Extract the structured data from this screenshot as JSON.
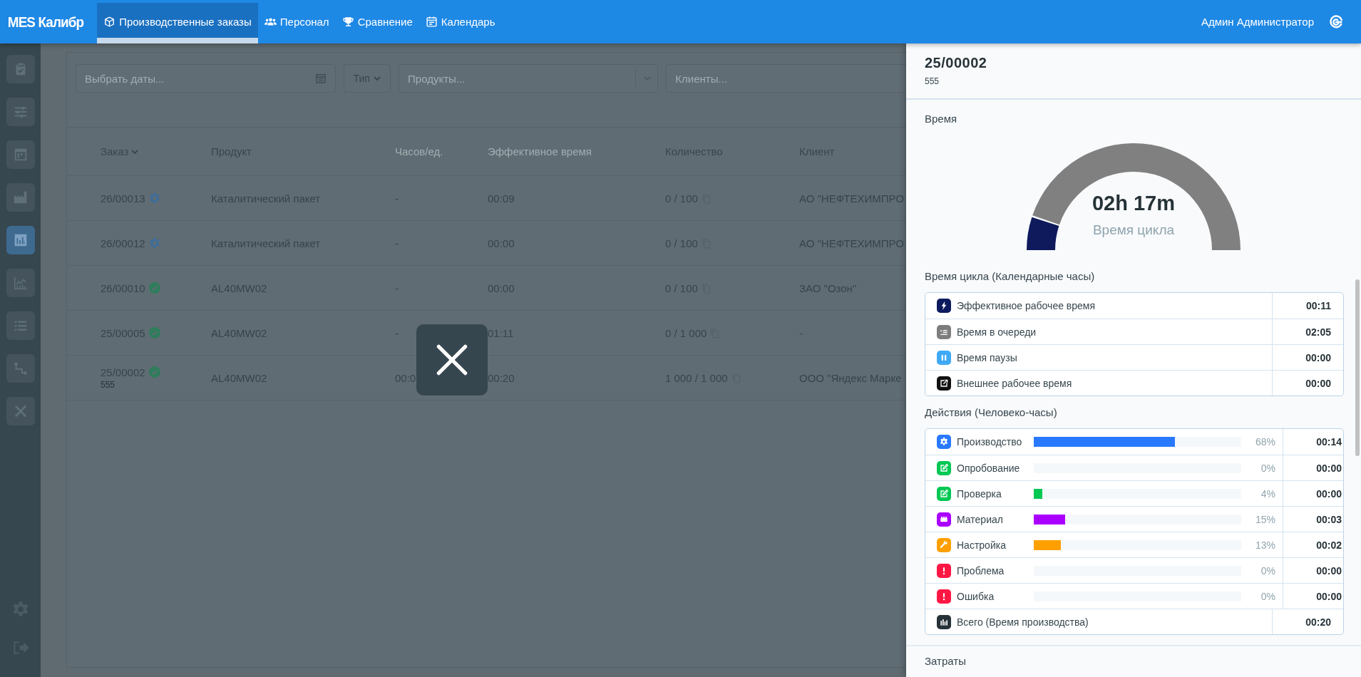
{
  "topbar": {
    "logo": "MES Калибр",
    "tabs": [
      {
        "label": "Производственные заказы",
        "selected": true
      },
      {
        "label": "Персонал",
        "selected": false
      },
      {
        "label": "Сравнение",
        "selected": false
      },
      {
        "label": "Календарь",
        "selected": false
      }
    ],
    "user": "Админ Администратор"
  },
  "sidebar": {
    "items": [
      {
        "selected": false
      },
      {
        "selected": false
      },
      {
        "selected": false
      },
      {
        "selected": false
      },
      {
        "selected": true
      },
      {
        "selected": false
      },
      {
        "selected": false
      },
      {
        "selected": false
      },
      {
        "selected": false
      }
    ]
  },
  "filters": {
    "dates": {
      "placeholder": "Выбрать даты..."
    },
    "type": {
      "label": "Тип"
    },
    "products": {
      "placeholder": "Продукты..."
    },
    "clients": {
      "placeholder": "Клиенты..."
    }
  },
  "table": {
    "columns": [
      {
        "label": "Заказ",
        "sorted": true,
        "dimmed": false
      },
      {
        "label": "Продукт",
        "sorted": false,
        "dimmed": false
      },
      {
        "label": "Часов/ед.",
        "sorted": false,
        "dimmed": true
      },
      {
        "label": "Эффективное время",
        "sorted": false,
        "dimmed": true
      },
      {
        "label": "Количество",
        "sorted": false,
        "dimmed": false
      },
      {
        "label": "Клиент",
        "sorted": false,
        "dimmed": false
      }
    ],
    "rows": [
      {
        "order": "26/00013",
        "completed": false,
        "product": "Каталитический пакет",
        "hours": "-",
        "effective_time": "00:09",
        "quantity": "0 / 100",
        "client": "АО \"НЕФТЕХИМПРО"
      },
      {
        "order": "26/00012",
        "completed": false,
        "product": "Каталитический пакет",
        "hours": "-",
        "effective_time": "00:00",
        "quantity": "0 / 100",
        "client": "АО \"НЕФТЕХИМПРО"
      },
      {
        "order": "26/00010",
        "completed": true,
        "product": "AL40MW02",
        "hours": "-",
        "effective_time": "00:00",
        "quantity": "0 / 100",
        "client": "ЗАО \"Озон\""
      },
      {
        "order": "25/00005",
        "completed": true,
        "product": "AL40MW02",
        "hours": "-",
        "effective_time": "01:11",
        "quantity": "0 / 1 000",
        "client": "-"
      },
      {
        "order": "25/00002",
        "completed": true,
        "note": "555",
        "product": "AL40MW02",
        "hours": "00:0",
        "effective_time": "00:20",
        "quantity": "1 000 / 1 000",
        "client": "ООО \"Яндекс Марке"
      }
    ]
  },
  "panel": {
    "title": "25/00002",
    "subtitle": "555",
    "time_section": "Время",
    "gauge": {
      "value": "02h 17m",
      "caption": "Время цикла"
    },
    "cycle_heading": "Время цикла (Календарные часы)",
    "cycle_rows": [
      {
        "label": "Эффективное рабочее время",
        "value": "00:11",
        "color": "#0d1b5e"
      },
      {
        "label": "Время в очереди",
        "value": "02:05",
        "color": "#7d7d7d"
      },
      {
        "label": "Время паузы",
        "value": "00:00",
        "color": "#3fa9f5"
      },
      {
        "label": "Внешнее рабочее время",
        "value": "00:00",
        "color": "#111111"
      }
    ],
    "actions_heading": "Действия (Человеко-часы)",
    "action_rows": [
      {
        "kind": "activity",
        "label": "Производство",
        "level": 0.68,
        "percent": "68%",
        "value": "00:14",
        "color": "#2979ff"
      },
      {
        "kind": "activity",
        "label": "Опробование",
        "level": 0,
        "percent": "0%",
        "value": "00:00",
        "color": "#00c853"
      },
      {
        "kind": "activity",
        "label": "Проверка",
        "level": 0.04,
        "percent": "4%",
        "value": "00:00",
        "color": "#00c853"
      },
      {
        "kind": "activity",
        "label": "Материал",
        "level": 0.15,
        "percent": "15%",
        "value": "00:03",
        "color": "#aa00ff"
      },
      {
        "kind": "activity",
        "label": "Настройка",
        "level": 0.13,
        "percent": "13%",
        "value": "00:02",
        "color": "#ffa000"
      },
      {
        "kind": "activity",
        "label": "Проблема",
        "level": 0,
        "percent": "0%",
        "value": "00:00",
        "color": "#ff1744"
      },
      {
        "kind": "activity",
        "label": "Ошибка",
        "level": 0,
        "percent": "0%",
        "value": "00:00",
        "color": "#ff1744"
      },
      {
        "kind": "total",
        "label": "Всего (Время производства)",
        "value": "00:20"
      }
    ],
    "costs_heading": "Затраты"
  }
}
